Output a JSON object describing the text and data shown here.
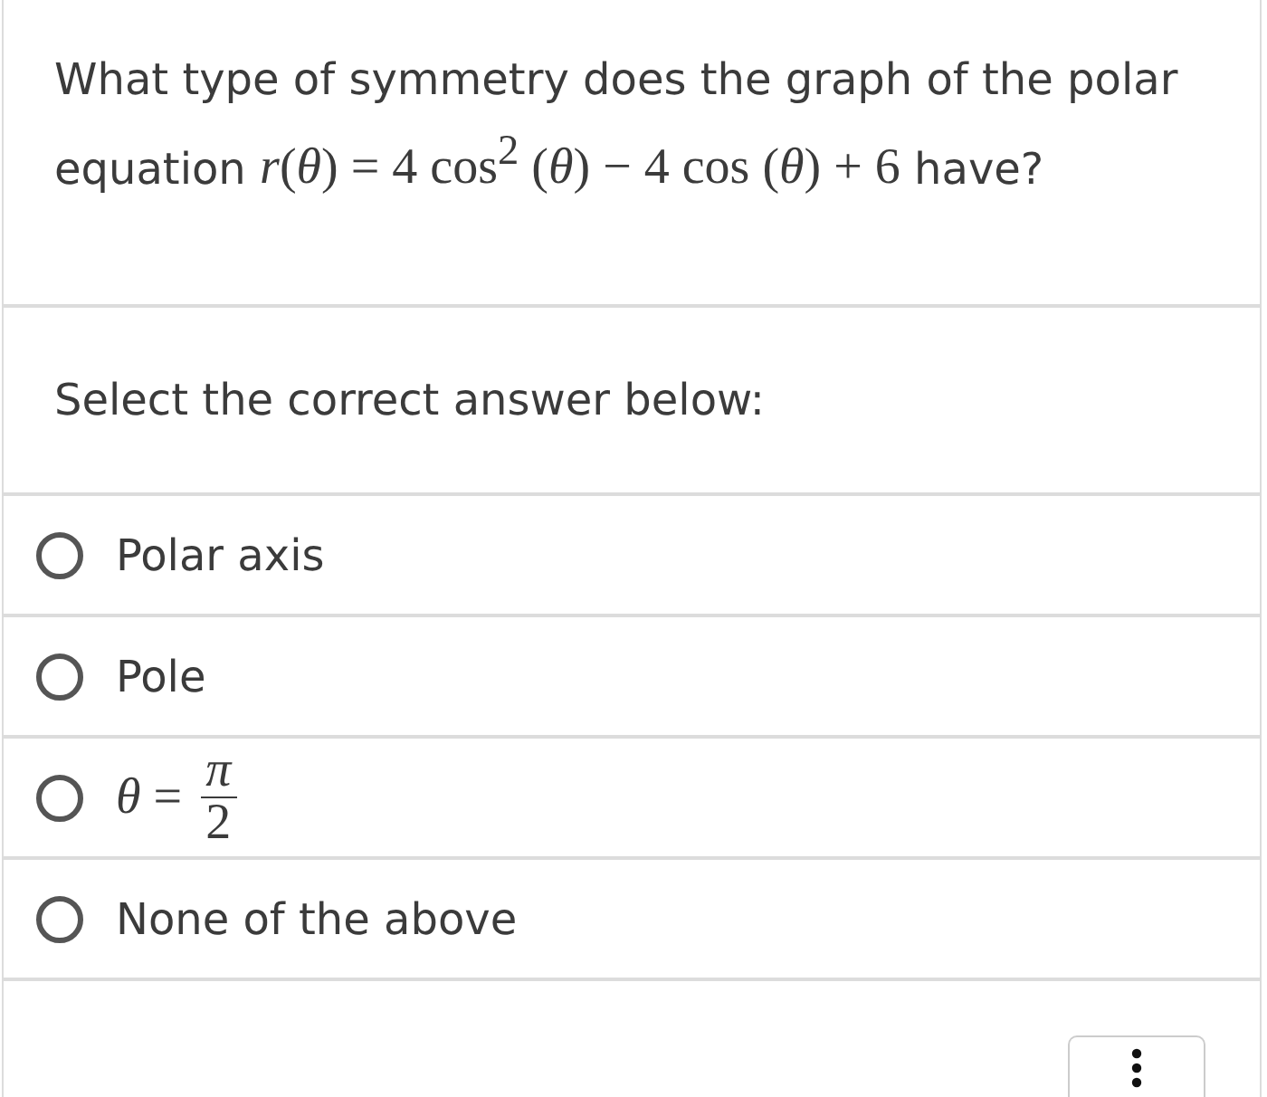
{
  "question": {
    "text_before": "What type of symmetry does the graph of the polar equation",
    "equation": "*r*(*θ*) = 4 cos$^{2}$ (*θ*) − 4 cos (*θ*) + 6",
    "text_after": "have?"
  },
  "prompt": "Select the correct answer below:",
  "options": [
    {
      "kind": "text",
      "label": "Polar axis",
      "selected": false
    },
    {
      "kind": "text",
      "label": "Pole",
      "selected": false
    },
    {
      "kind": "fraction",
      "lhs": "*θ* =",
      "numerator": "*π*",
      "denominator": "2",
      "selected": false
    },
    {
      "kind": "text",
      "label": "None of the above",
      "selected": false
    }
  ]
}
